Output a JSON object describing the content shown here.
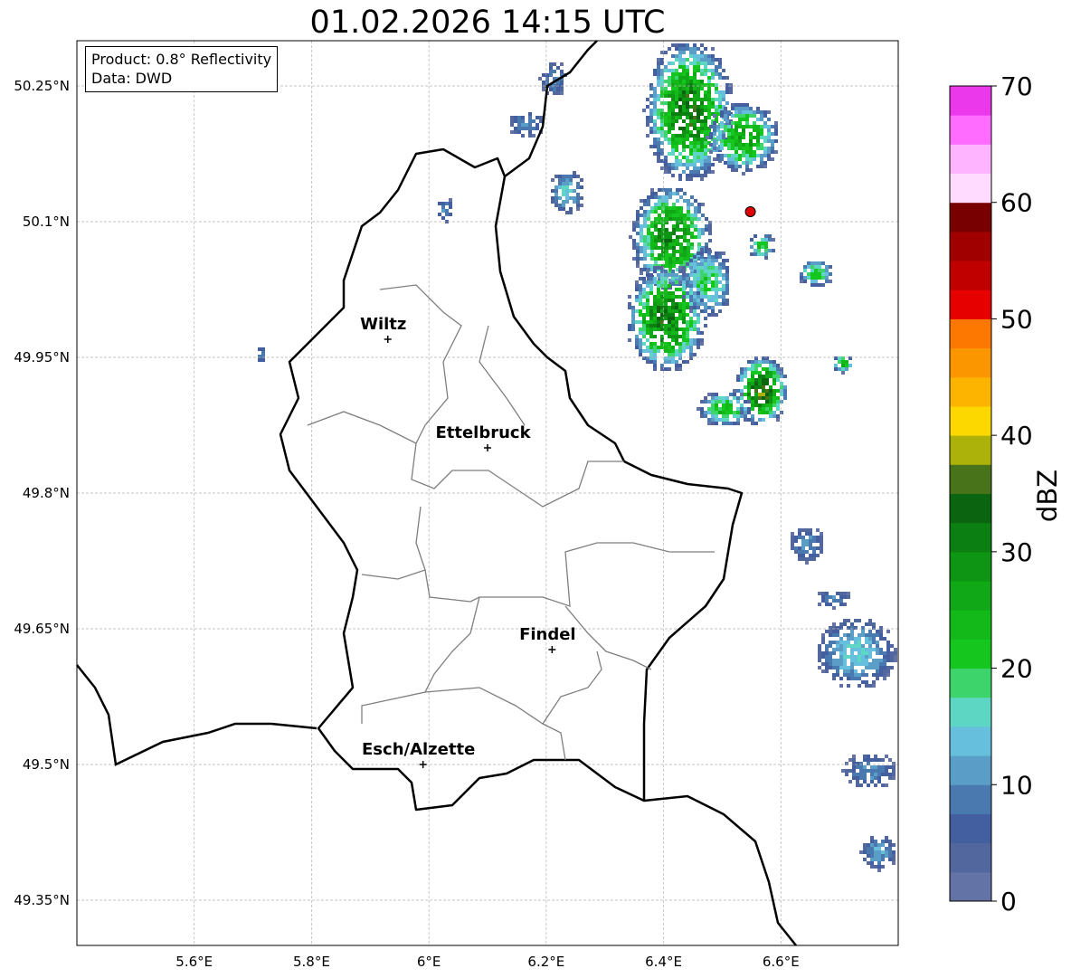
{
  "title": "01.02.2026 14:15 UTC",
  "info_box": {
    "product": "Product: 0.8° Reflectivity",
    "data": "Data: DWD"
  },
  "map": {
    "lon_range": [
      5.4,
      6.8
    ],
    "lat_range": [
      49.3,
      50.3
    ],
    "lon_ticks": [
      {
        "value": 5.6,
        "label": "5.6°E"
      },
      {
        "value": 5.8,
        "label": "5.8°E"
      },
      {
        "value": 6.0,
        "label": "6°E"
      },
      {
        "value": 6.2,
        "label": "6.2°E"
      },
      {
        "value": 6.4,
        "label": "6.4°E"
      },
      {
        "value": 6.6,
        "label": "6.6°E"
      }
    ],
    "lat_ticks": [
      {
        "value": 50.25,
        "label": "50.25°N"
      },
      {
        "value": 50.1,
        "label": "50.1°N"
      },
      {
        "value": 49.95,
        "label": "49.95°N"
      },
      {
        "value": 49.8,
        "label": "49.8°N"
      },
      {
        "value": 49.65,
        "label": "49.65°N"
      },
      {
        "value": 49.5,
        "label": "49.5°N"
      },
      {
        "value": 49.35,
        "label": "49.35°N"
      }
    ],
    "grid": true,
    "cities": [
      {
        "name": "Wiltz",
        "lon": 5.93,
        "lat": 49.97
      },
      {
        "name": "Ettelbruck",
        "lon": 6.1,
        "lat": 49.85
      },
      {
        "name": "Findel",
        "lon": 6.21,
        "lat": 49.627
      },
      {
        "name": "Esch/Alzette",
        "lon": 5.99,
        "lat": 49.5
      }
    ],
    "radar_site": {
      "lon": 6.548,
      "lat": 50.111,
      "color": "#e00000"
    }
  },
  "colorbar": {
    "label": "dBZ",
    "min": 0,
    "max": 70,
    "step": 2.5,
    "ticks": [
      0,
      10,
      20,
      30,
      40,
      50,
      60,
      70
    ],
    "colors": [
      "#6473a6",
      "#53679f",
      "#445f9f",
      "#4a79b0",
      "#5a9ec7",
      "#66bfdc",
      "#5ed6c4",
      "#3ed46c",
      "#14c61e",
      "#12b919",
      "#10a816",
      "#0e9514",
      "#0c7f12",
      "#0a6410",
      "#48731a",
      "#acb20a",
      "#fcd700",
      "#fcb400",
      "#fc9600",
      "#fc7800",
      "#e60000",
      "#c00000",
      "#a00000",
      "#780000",
      "#ffdcff",
      "#ffb4ff",
      "#ff6cff",
      "#ea38ea"
    ]
  }
}
